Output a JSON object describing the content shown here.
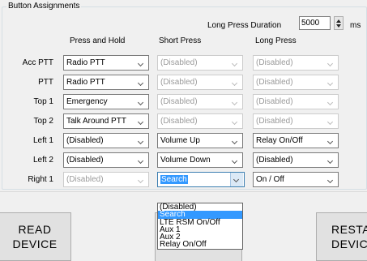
{
  "group": {
    "title": "Button Assignments"
  },
  "long_press": {
    "label": "Long Press Duration",
    "value": "5000",
    "unit": "ms"
  },
  "columns": [
    "Press and Hold",
    "Short Press",
    "Long Press"
  ],
  "rows": [
    {
      "label": "Acc PTT",
      "press_and_hold": "Radio PTT",
      "short_press": "(Disabled)",
      "long_press": "(Disabled)"
    },
    {
      "label": "PTT",
      "press_and_hold": "Radio PTT",
      "short_press": "(Disabled)",
      "long_press": "(Disabled)"
    },
    {
      "label": "Top 1",
      "press_and_hold": "Emergency",
      "short_press": "(Disabled)",
      "long_press": "(Disabled)"
    },
    {
      "label": "Top 2",
      "press_and_hold": "Talk Around PTT",
      "short_press": "(Disabled)",
      "long_press": "(Disabled)"
    },
    {
      "label": "Left 1",
      "press_and_hold": "(Disabled)",
      "short_press": "Volume Up",
      "long_press": "Relay On/Off"
    },
    {
      "label": "Left 2",
      "press_and_hold": "(Disabled)",
      "short_press": "Volume Down",
      "long_press": "(Disabled)"
    },
    {
      "label": "Right 1",
      "press_and_hold": "(Disabled)",
      "short_press": "Search",
      "long_press": "On / Off"
    }
  ],
  "dropdown_options": [
    "(Disabled)",
    "Search",
    "LTE RSM On/Off",
    "Aux 1",
    "Aux 2",
    "Relay On/Off"
  ],
  "dropdown_selected": "Search",
  "buttons": {
    "read_line1": "READ",
    "read_line2": "DEVICE",
    "restore_line1": "RESTA",
    "restore_line2": "DEVIC"
  }
}
